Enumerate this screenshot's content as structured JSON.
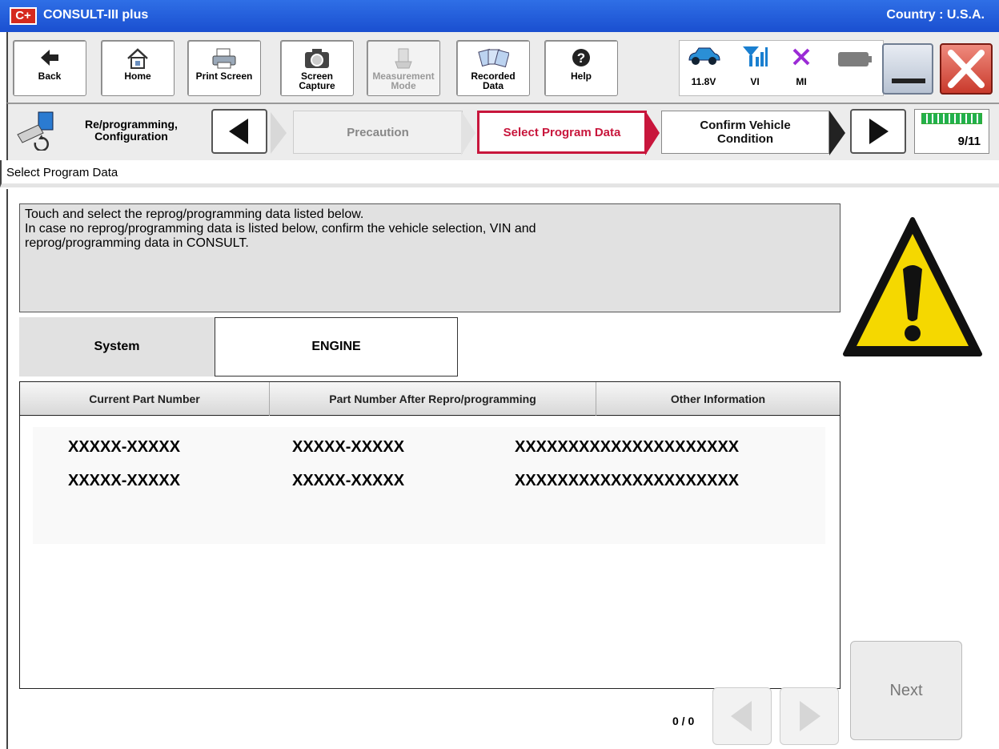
{
  "window": {
    "logo": "C+",
    "title": "CONSULT-III plus",
    "country": "Country : U.S.A."
  },
  "toolbar": {
    "buttons": [
      {
        "label": "Back",
        "icon": "back-arrow-icon"
      },
      {
        "label": "Home",
        "icon": "home-icon"
      },
      {
        "label": "Print Screen",
        "icon": "printer-icon"
      },
      {
        "label": "Screen\nCapture",
        "icon": "camera-icon"
      },
      {
        "label": "Measurement\nMode",
        "icon": "measurement-icon",
        "disabled": true
      },
      {
        "label": "Recorded\nData",
        "icon": "recorded-data-icon"
      },
      {
        "label": "Help",
        "icon": "help-icon"
      }
    ],
    "status": {
      "voltage": "11.8V",
      "vi": "VI",
      "mi": "MI"
    }
  },
  "breadcrumb": {
    "mode_label": "Re/programming,\nConfiguration",
    "steps": [
      {
        "label": "Precaution",
        "state": "done"
      },
      {
        "label": "Select Program Data",
        "state": "active"
      },
      {
        "label": "Confirm Vehicle\nCondition",
        "state": "next"
      }
    ],
    "progress": "9/11",
    "progress_fraction": 0.818
  },
  "section_title": "Select Program Data",
  "message": "Touch and select the reprog/programming data listed below.\nIn case no reprog/programming data is listed below, confirm the vehicle selection, VIN and\nreprog/programming data in CONSULT.",
  "system": {
    "label": "System",
    "value": "ENGINE"
  },
  "table": {
    "headers": [
      "Current Part Number",
      "Part Number After Repro/programming",
      "Other Information"
    ],
    "rows": [
      [
        "XXXXX-XXXXX",
        "XXXXX-XXXXX",
        "XXXXXXXXXXXXXXXXXXXXX"
      ],
      [
        "XXXXX-XXXXX",
        "XXXXX-XXXXX",
        "XXXXXXXXXXXXXXXXXXXXX"
      ]
    ]
  },
  "pager": {
    "text": "0 / 0"
  },
  "next_label": "Next",
  "colors": {
    "title_bar": "#1a4fd0",
    "active_step": "#c8163c",
    "progress": "#22b14c",
    "warning": "#f5d800"
  }
}
